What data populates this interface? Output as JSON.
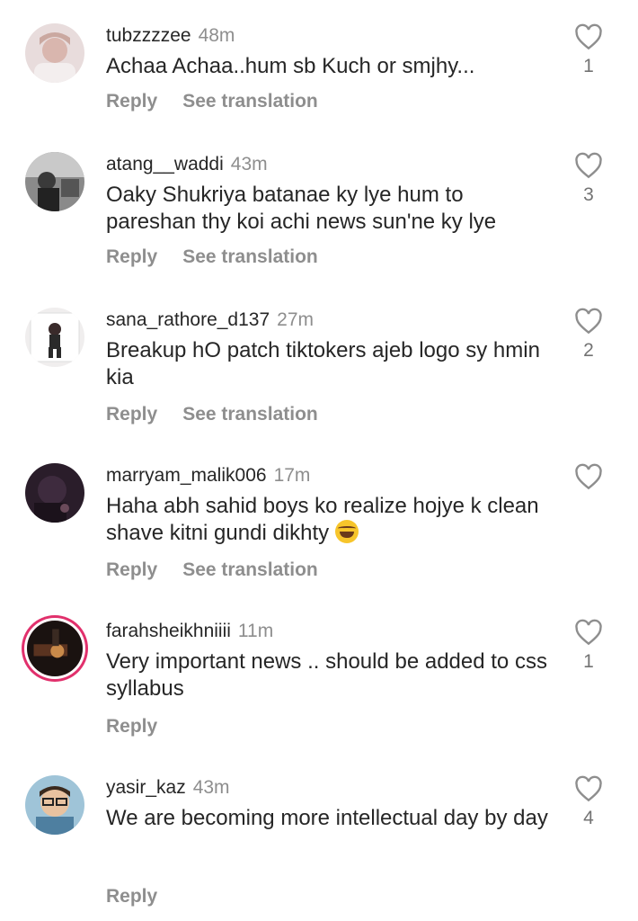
{
  "icons": {
    "like": "heart-outline-icon"
  },
  "actions": {
    "reply": "Reply",
    "translate": "See translation"
  },
  "comments": [
    {
      "username": "tubzzzzee",
      "time": "48m",
      "text": "Achaa Achaa..hum sb Kuch or smjhy...",
      "likes": "1"
    },
    {
      "username": "atang__waddi",
      "time": "43m",
      "text": "Oaky Shukriya batanae ky lye hum to pareshan thy koi achi news sun'ne ky lye",
      "likes": "3"
    },
    {
      "username": "sana_rathore_d137",
      "time": "27m",
      "text": "Breakup hO patch tiktokers ajeb logo sy hmin kia",
      "likes": "2"
    },
    {
      "username": "marryam_malik006",
      "time": "17m",
      "text": "Haha abh sahid boys ko realize hojye k clean shave kitni gundi dikhty",
      "likes": ""
    },
    {
      "username": "farahsheikhniiii",
      "time": "11m",
      "text": "Very important news .. should be added to css syllabus",
      "likes": "1"
    },
    {
      "username": "yasir_kaz",
      "time": "43m",
      "text": "We are becoming more intellectual day by day",
      "likes": "4"
    }
  ]
}
